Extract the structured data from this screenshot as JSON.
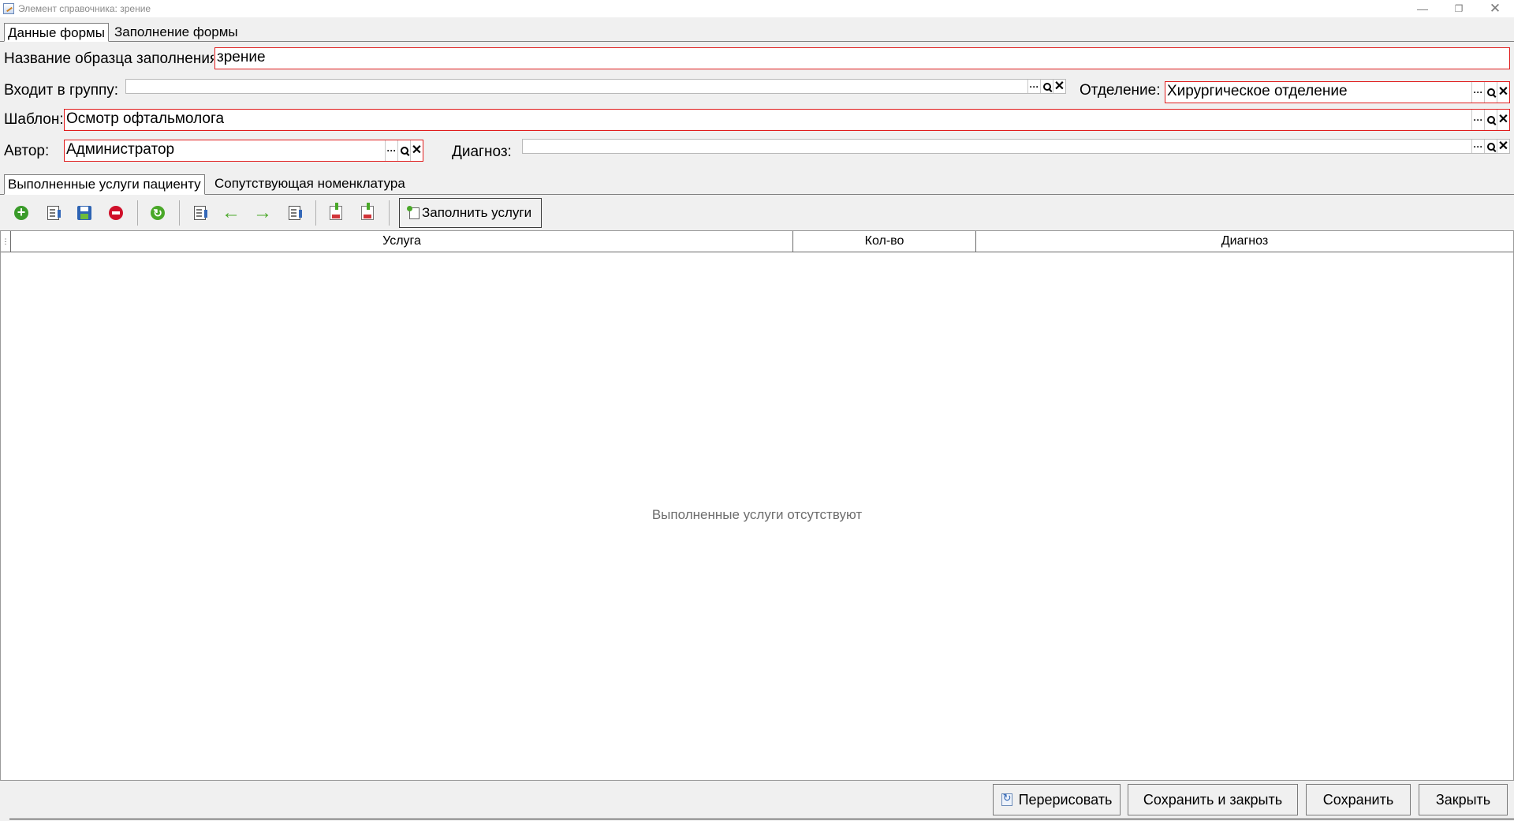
{
  "window": {
    "title": "Элемент справочника: зрение",
    "icon": "catalog-edit-icon",
    "minimize": "—",
    "maximize": "❐",
    "close": "✕"
  },
  "top_tabs": [
    {
      "label": "Данные формы",
      "active": true
    },
    {
      "label": "Заполнение формы",
      "active": false
    }
  ],
  "form": {
    "name_label": "Название образца заполнения:",
    "name_value": "зрение",
    "group_label": "Входит в группу:",
    "group_value": "",
    "department_label": "Отделение:",
    "department_value": "Хирургическое отделение",
    "template_label": "Шаблон:",
    "template_value": "Осмотр офтальмолога",
    "author_label": "Автор:",
    "author_value": "Администратор",
    "diagnosis_label": "Диагноз:",
    "diagnosis_value": "",
    "btn_select": "···",
    "btn_clear": "✕"
  },
  "inner_tabs": [
    {
      "label": "Выполненные услуги пациенту",
      "active": true
    },
    {
      "label": "Сопутствующая номенклатура",
      "active": false
    }
  ],
  "toolbar": {
    "icons": [
      "add-icon",
      "edit-icon",
      "save-icon",
      "delete-icon",
      "refresh-icon",
      "copy-icon",
      "arrow-left-icon",
      "arrow-right-icon",
      "copy-icon",
      "import-excel-icon",
      "export-excel-icon"
    ],
    "fill_services_label": "Заполнить услуги"
  },
  "grid": {
    "columns": [
      "Услуга",
      "Кол-во",
      "Диагноз"
    ],
    "rows": [],
    "empty_message": "Выполненные услуги отсутствуют"
  },
  "footer": {
    "redraw_label": "Перерисовать",
    "save_close_label": "Сохранить и закрыть",
    "save_label": "Сохранить",
    "close_label": "Закрыть"
  },
  "colors": {
    "required_border": "#e01c1c",
    "accent_green": "#4aa829",
    "accent_blue": "#2d63b3"
  }
}
